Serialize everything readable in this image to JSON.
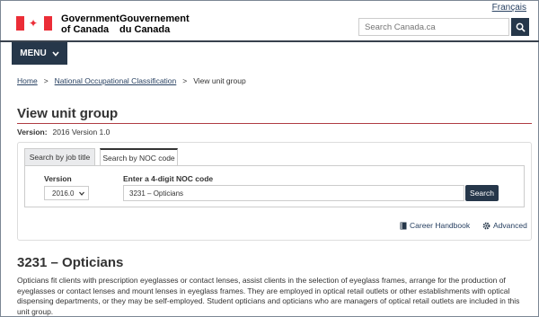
{
  "header": {
    "language_link": "Français",
    "gov_en_line1": "Government",
    "gov_en_line2": "of Canada",
    "gov_fr_line1": "Gouvernement",
    "gov_fr_line2": "du Canada",
    "search_placeholder": "Search Canada.ca",
    "menu_label": "MENU",
    "flag_color": "#eb2d37",
    "nav_color": "#26374a"
  },
  "breadcrumb": {
    "items": [
      "Home",
      "National Occupational Classification",
      "View unit group"
    ],
    "separator": ">"
  },
  "page": {
    "title": "View unit group",
    "version_label": "Version:",
    "version_value": "2016 Version 1.0",
    "title_rule_color": "#af3c43"
  },
  "search_panel": {
    "tabs": [
      "Search by job title",
      "Search by NOC code"
    ],
    "active_tab": "Search by NOC code",
    "version_label": "Version",
    "version_selected": "2016.0",
    "code_label": "Enter a 4-digit NOC code",
    "code_value": "3231 – Opticians",
    "search_button": "Search",
    "career_handbook": "Career Handbook",
    "advanced": "Advanced"
  },
  "result": {
    "title": "3231 – Opticians",
    "description": "Opticians fit clients with prescription eyeglasses or contact lenses, assist clients in the selection of eyeglass frames, arrange for the production of eyeglasses or contact lenses and mount lenses in eyeglass frames. They are employed in optical retail outlets or other establishments with optical dispensing departments, or they may be self-employed. Student opticians and opticians who are managers of optical retail outlets are included in this unit group."
  }
}
